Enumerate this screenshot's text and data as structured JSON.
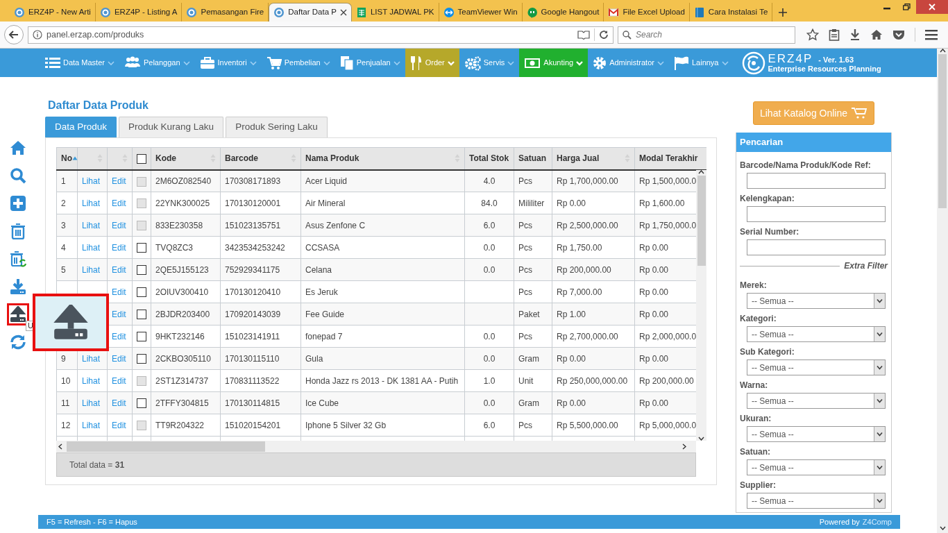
{
  "browser": {
    "tabs": [
      {
        "title": "ERZ4P - New Arti",
        "selected": false
      },
      {
        "title": "ERZ4P - Listing A",
        "selected": false
      },
      {
        "title": "Pemasangan Fire",
        "selected": false
      },
      {
        "title": "Daftar Data P",
        "selected": true
      },
      {
        "title": "LIST JADWAL PK",
        "selected": false
      },
      {
        "title": "TeamViewer Win",
        "selected": false
      },
      {
        "title": "Google Hangout",
        "selected": false
      },
      {
        "title": "File Excel Upload",
        "selected": false
      },
      {
        "title": "Cara Instalasi Te",
        "selected": false
      }
    ],
    "address": "panel.erzap.com/produks",
    "search": {
      "placeholder": "Search"
    }
  },
  "navbar": {
    "items": [
      {
        "label": "Data Master"
      },
      {
        "label": "Pelanggan"
      },
      {
        "label": "Inventori"
      },
      {
        "label": "Pembelian"
      },
      {
        "label": "Penjualan"
      },
      {
        "label": "Order",
        "color": "#b6a82a"
      },
      {
        "label": "Servis"
      },
      {
        "label": "Akunting",
        "color": "#21b02f"
      },
      {
        "label": "Administrator"
      },
      {
        "label": "Lainnya"
      }
    ],
    "logo": {
      "name": "ERZ4P",
      "version": "- Ver. 1.63",
      "tagline": "Enterprise Resources Planning"
    }
  },
  "toolbar": [
    {
      "highlighted": false
    },
    {
      "highlighted": false
    },
    {
      "highlighted": false
    },
    {
      "highlighted": false
    },
    {
      "highlighted": false
    },
    {
      "highlighted": false
    },
    {
      "highlighted": true
    },
    {
      "highlighted": false
    }
  ],
  "tooltip": {
    "text": "U"
  },
  "page": {
    "title": "Daftar Data Produk",
    "tabs": [
      {
        "label": "Data Produk",
        "selected": true
      },
      {
        "label": "Produk Kurang Laku",
        "selected": false
      },
      {
        "label": "Produk Sering Laku",
        "selected": false
      }
    ],
    "table": {
      "columns": [
        {
          "label": "No",
          "sortable": true,
          "sorted": true
        },
        {
          "sortable": true,
          "sorted": false
        },
        {
          "sortable": true,
          "sorted": false
        },
        {
          "kind": "checkbox",
          "checked": false
        },
        {
          "label": "Kode",
          "sortable": true,
          "sorted": false
        },
        {
          "label": "Barcode",
          "sortable": true,
          "sorted": false
        },
        {
          "label": "Nama Produk",
          "sortable": true,
          "sorted": false
        },
        {
          "label": "Total Stok"
        },
        {
          "label": "Satuan"
        },
        {
          "label": "Harga Jual",
          "sortable": true,
          "sorted": false
        },
        {
          "label": "Modal Terakhir"
        }
      ],
      "rows": [
        {
          "no": "1",
          "lihat": "Lihat",
          "edit": "Edit",
          "checked": false,
          "disabled": true,
          "kode": "2M6OZ082540",
          "barcode": "170308171893",
          "nama": "Acer Liquid",
          "stok": "4.0",
          "satuan": "Pcs",
          "harga": "Rp 1,700,000.00",
          "modal": "Rp 1,500,000.0"
        },
        {
          "no": "2",
          "lihat": "Lihat",
          "edit": "Edit",
          "checked": false,
          "disabled": true,
          "kode": "22YNK300025",
          "barcode": "170130120001",
          "nama": "Air Mineral",
          "stok": "84.0",
          "satuan": "Mililiter",
          "harga": "Rp 0.00",
          "modal": "Rp 1,600.00"
        },
        {
          "no": "3",
          "lihat": "Lihat",
          "edit": "Edit",
          "checked": false,
          "disabled": true,
          "kode": "833E230358",
          "barcode": "151023135751",
          "nama": "Asus Zenfone C",
          "stok": "6.0",
          "satuan": "Pcs",
          "harga": "Rp 2,500,000.00",
          "modal": "Rp 1,750,000.0"
        },
        {
          "no": "4",
          "lihat": "Lihat",
          "edit": "Edit",
          "checked": false,
          "disabled": false,
          "kode": "TVQ8ZC3",
          "barcode": "3423534253242",
          "nama": "CCSASA",
          "stok": "0.0",
          "satuan": "Pcs",
          "harga": "Rp 1,750.00",
          "modal": "Rp 0.00"
        },
        {
          "no": "5",
          "lihat": "Lihat",
          "edit": "Edit",
          "checked": false,
          "disabled": false,
          "kode": "2QE5J155123",
          "barcode": "752929341175",
          "nama": "Celana",
          "stok": "0.0",
          "satuan": "Pcs",
          "harga": "Rp 200,000.00",
          "modal": "Rp 0.00"
        },
        {
          "edit": "Edit",
          "checked": false,
          "disabled": false,
          "kode": "2OIUV300410",
          "barcode": "170130120410",
          "nama": "Es Jeruk",
          "satuan": "Pcs",
          "harga": "Rp 7,000.00",
          "modal": "Rp 0.00"
        },
        {
          "edit": "Edit",
          "checked": false,
          "disabled": false,
          "kode": "2BJDR203400",
          "barcode": "170920143039",
          "nama": "Fee Guide",
          "satuan": "Paket",
          "harga": "Rp 1.00",
          "modal": "Rp 0.00"
        },
        {
          "edit": "Edit",
          "checked": false,
          "disabled": false,
          "kode": "9HKT232146",
          "barcode": "151023141911",
          "nama": "fonepad 7",
          "stok": "0.0",
          "satuan": "Pcs",
          "harga": "Rp 2,700,000.00",
          "modal": "Rp 2,000,000.0"
        },
        {
          "no": "9",
          "lihat": "Lihat",
          "edit": "Edit",
          "checked": false,
          "disabled": false,
          "kode": "2CKBO305110",
          "barcode": "170130115110",
          "nama": "Gula",
          "stok": "0.0",
          "satuan": "Gram",
          "harga": "Rp 0.00",
          "modal": "Rp 0.00"
        },
        {
          "no": "10",
          "lihat": "Lihat",
          "edit": "Edit",
          "checked": false,
          "disabled": true,
          "kode": "2ST1Z314737",
          "barcode": "170831113522",
          "nama": "Honda Jazz rs 2013 - DK 1381 AA - Putih",
          "stok": "1.0",
          "satuan": "Unit",
          "harga": "Rp 250,000,000.00",
          "modal": "Rp 200,000.00"
        },
        {
          "no": "11",
          "lihat": "Lihat",
          "edit": "Edit",
          "checked": false,
          "disabled": false,
          "kode": "2TFFY304815",
          "barcode": "170130114815",
          "nama": "Ice Cube",
          "stok": "0.0",
          "satuan": "Gram",
          "harga": "Rp 0.00",
          "modal": "Rp 0.00"
        },
        {
          "no": "12",
          "lihat": "Lihat",
          "edit": "Edit",
          "checked": false,
          "disabled": true,
          "kode": "TT9R204322",
          "barcode": "151020154201",
          "nama": "Iphone 5 Silver 32 Gb",
          "stok": "6.0",
          "satuan": "Pcs",
          "harga": "Rp 5,500,000.00",
          "modal": "Rp 5,000,000.0"
        }
      ]
    },
    "total": "Total data =  **31**"
  },
  "side": {
    "catalog_button": "Lihat Katalog Online",
    "search_panel": {
      "title": "Pencarian",
      "fields": [
        {
          "kind": "text",
          "label": "Barcode/Nama Produk/Kode Ref:"
        },
        {
          "kind": "text",
          "label": "Kelengkapan:"
        },
        {
          "kind": "text",
          "label": "Serial Number:"
        },
        {
          "kind": "divider",
          "label": "Extra Filter"
        },
        {
          "kind": "select",
          "label": "Merek:",
          "value": "-- Semua --"
        },
        {
          "kind": "select",
          "label": "Kategori:",
          "value": "-- Semua --"
        },
        {
          "kind": "select",
          "label": "Sub Kategori:",
          "value": "-- Semua --"
        },
        {
          "kind": "select",
          "label": "Warna:",
          "value": "-- Semua --"
        },
        {
          "kind": "select",
          "label": "Ukuran:",
          "value": "-- Semua --"
        },
        {
          "kind": "select",
          "label": "Satuan:",
          "value": "-- Semua --"
        },
        {
          "kind": "select",
          "label": "Supplier:",
          "value": "-- Semua --"
        }
      ]
    }
  },
  "status_bar": {
    "shortcuts": "F5 = Refresh - F6 = Hapus",
    "credit": "Powered by",
    "credit_link": "Z4Comp"
  }
}
